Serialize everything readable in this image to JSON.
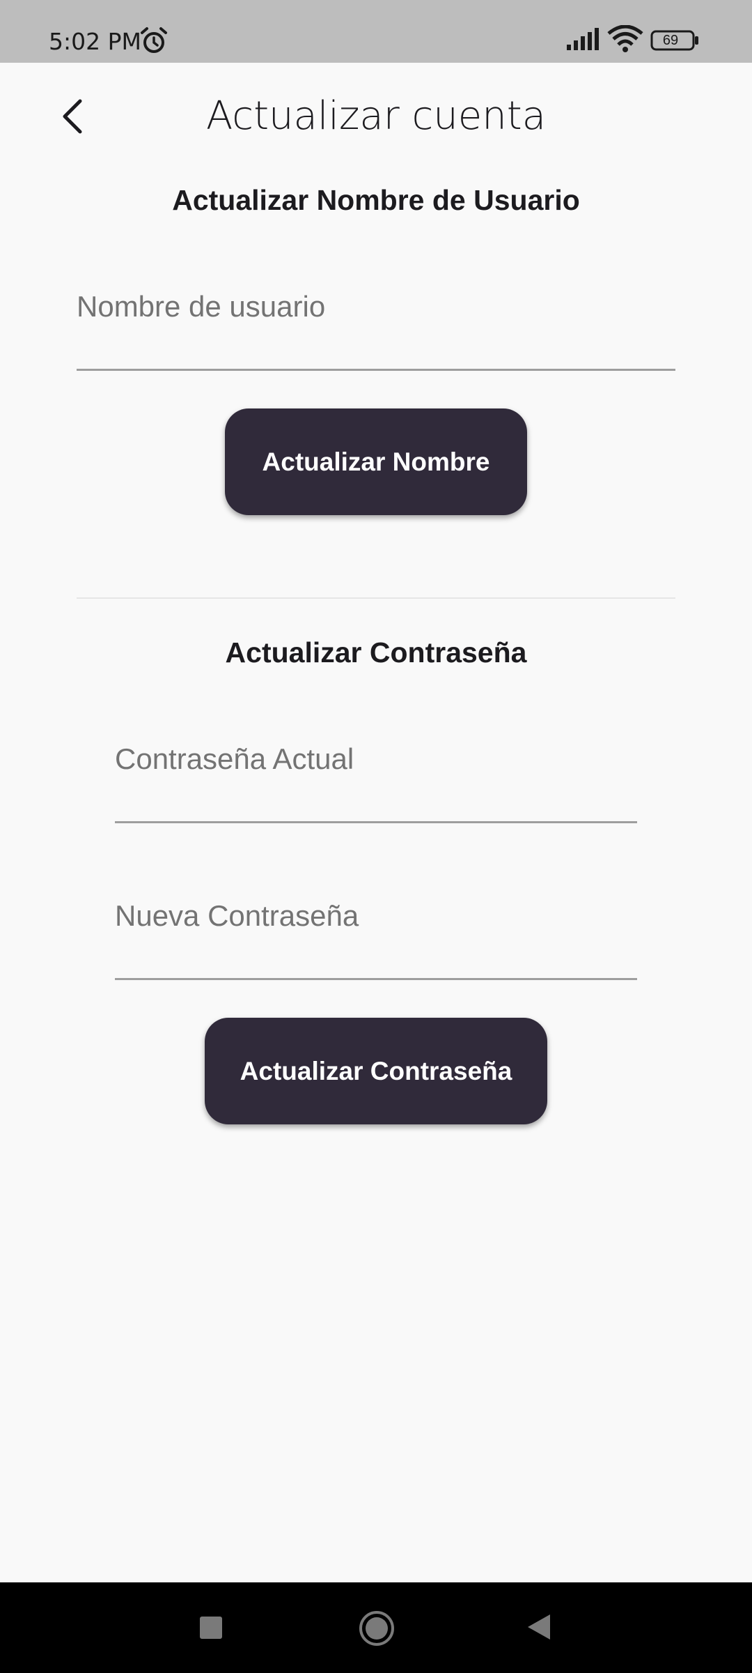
{
  "status_bar": {
    "time": "5:02 PM",
    "battery": "69"
  },
  "header": {
    "title": "Actualizar cuenta"
  },
  "username_section": {
    "title": "Actualizar Nombre de Usuario",
    "username_placeholder": "Nombre de usuario",
    "button_label": "Actualizar Nombre"
  },
  "password_section": {
    "title": "Actualizar Contraseña",
    "current_password_placeholder": "Contraseña Actual",
    "new_password_placeholder": "Nueva Contraseña",
    "button_label": "Actualizar Contraseña"
  },
  "colors": {
    "button_bg": "#302a3a",
    "status_bar_bg": "#bdbdbd",
    "page_bg": "#f9f9f9"
  }
}
